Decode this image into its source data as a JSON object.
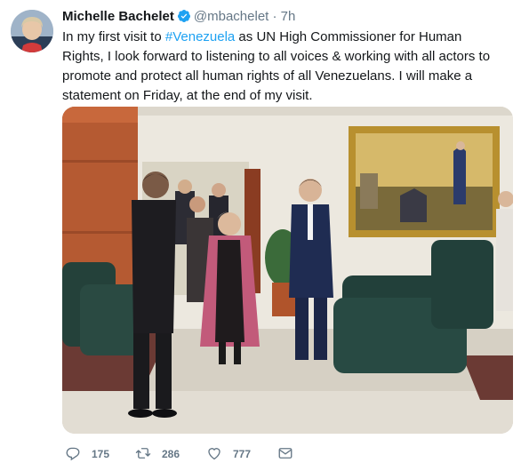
{
  "tweet": {
    "author_name": "Michelle Bachelet",
    "handle": "@mbachelet",
    "separator": "·",
    "time": "7h",
    "text_before": "In my first visit to ",
    "hashtag": "#Venezuela",
    "text_after": " as UN High Commissioner for Human Rights, I look forward to listening to all voices & working with all actors to promote and protect all human rights of all Venezuelans. I will make a statement on Friday, at the end of my visit."
  },
  "actions": {
    "replies": "175",
    "retweets": "286",
    "likes": "777"
  },
  "colors": {
    "accent": "#1da1f2",
    "secondary_text": "#657786"
  },
  "icons": [
    "verified-badge-icon",
    "reply-icon",
    "retweet-icon",
    "like-icon",
    "direct-message-icon"
  ]
}
